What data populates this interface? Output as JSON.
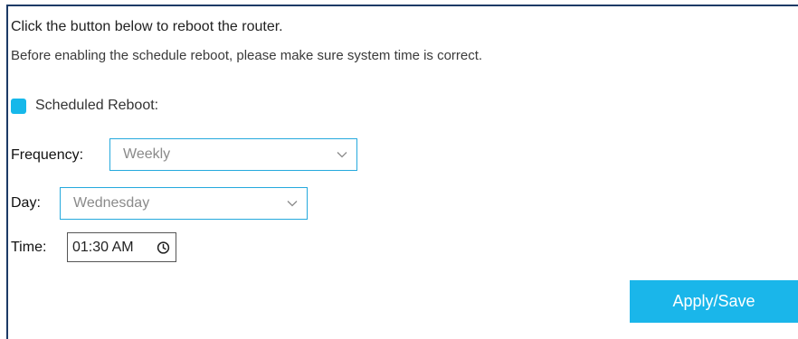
{
  "intro": {
    "line1": "Click the button below to reboot the router.",
    "line2": "Before enabling the schedule reboot, please make sure system time is correct."
  },
  "scheduled_reboot": {
    "label": "Scheduled Reboot:",
    "checked": true,
    "checkbox_color": "#16b8ea"
  },
  "frequency": {
    "label": "Frequency:",
    "value": "Weekly"
  },
  "day": {
    "label": "Day:",
    "value": "Wednesday"
  },
  "time": {
    "label": "Time:",
    "value": "01:30 AM",
    "icon": "clock-icon"
  },
  "actions": {
    "apply_label": "Apply/Save",
    "apply_color": "#1ab6ea"
  },
  "colors": {
    "accent": "#16b8ea",
    "border_dark": "#1c3a66",
    "select_border": "#25a9dd"
  }
}
